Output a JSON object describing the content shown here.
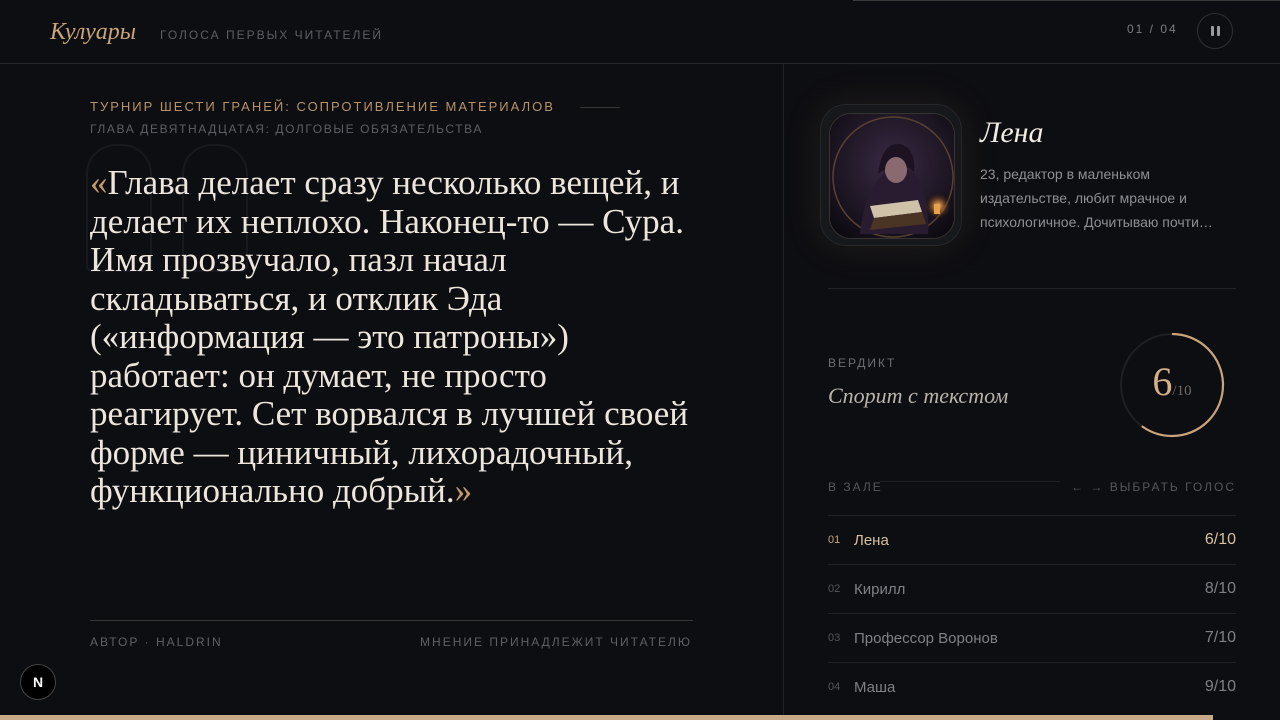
{
  "header": {
    "brand": "Кулуары",
    "tagline": "ГОЛОСА ПЕРВЫХ ЧИТАТЕЛЕЙ",
    "counter": "01 / 04",
    "pause_icon": "pause-icon"
  },
  "story": {
    "title": "ТУРНИР ШЕСТИ ГРАНЕЙ: СОПРОТИВЛЕНИЕ МАТЕРИАЛОВ",
    "chapter": "ГЛАВА ДЕВЯТНАДЦАТАЯ: ДОЛГОВЫЕ ОБЯЗАТЕЛЬСТВА",
    "quote_open": "«",
    "quote": "Глава делает сразу несколько вещей, и делает их неплохо. Наконец-то — Сура. Имя прозвучало, пазл начал складываться, и отклик Эда («информация — это патроны») работает: он думает, не просто реагирует. Сет ворвался в лучшей своей форме — циничный, лихорадочный, функционально добрый.",
    "quote_close": "»",
    "author": "АВТОР · HALDRIN",
    "opinion": "МНЕНИЕ ПРИНАДЛЕЖИТ ЧИТАТЕЛЮ"
  },
  "reader": {
    "name": "Лена",
    "bio": "23, редактор в маленьком издательстве, любит мрачное и психологичное. Дочитываю почти…",
    "verdict_label": "ВЕРДИКТ",
    "verdict": "Спорит с текстом",
    "score": "6",
    "score_max": "/10",
    "score_fraction": 0.6
  },
  "hall": {
    "label": "В ЗАЛЕ",
    "choose": "← → ВЫБРАТЬ ГОЛОС",
    "voices": [
      {
        "idx": "01",
        "name": "Лена",
        "score": "6/10"
      },
      {
        "idx": "02",
        "name": "Кирилл",
        "score": "8/10"
      },
      {
        "idx": "03",
        "name": "Профессор Воронов",
        "score": "7/10"
      },
      {
        "idx": "04",
        "name": "Маша",
        "score": "9/10"
      }
    ]
  },
  "badge": "N",
  "colors": {
    "accent": "#c9a47a",
    "background": "#0d0e12"
  }
}
